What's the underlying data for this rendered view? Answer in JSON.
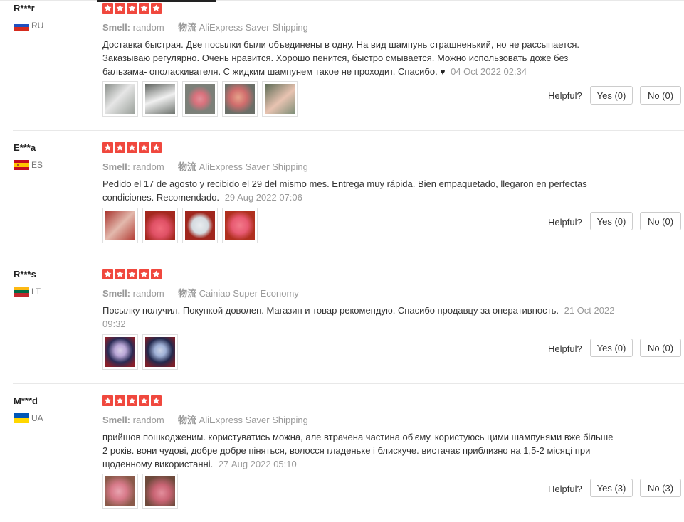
{
  "colors": {
    "star": "#f0483e",
    "accent": "#222222"
  },
  "reviews": [
    {
      "user": "R***r",
      "country_code": "RU",
      "flag": "russia",
      "rating": 5,
      "smell_label": "Smell:",
      "smell_value": "random",
      "shipping_label": "物流",
      "shipping_value": "AliExpress Saver Shipping",
      "text": "Доставка быстрая. Две посылки были объединены в одну. На вид шампунь страшненький, но не рассыпается. Заказываю регулярно. Очень нравится. Хорошо пенится, быстро смывается. Можно использовать доже без бальзама- ополаскивателя. С жидким шампунем такое не проходит. Спасибо.",
      "emoji": "♥",
      "date": "04 Oct 2022 02:34",
      "images": [
        "photo",
        "photo",
        "photo",
        "photo",
        "photo"
      ],
      "helpful_label": "Helpful?",
      "yes_label": "Yes (0)",
      "no_label": "No (0)"
    },
    {
      "user": "E***a",
      "country_code": "ES",
      "flag": "spain",
      "rating": 5,
      "smell_label": "Smell:",
      "smell_value": "random",
      "shipping_label": "物流",
      "shipping_value": "AliExpress Saver Shipping",
      "text": "Pedido el 17 de agosto y recibido el 29 del mismo mes. Entrega muy rápida. Bien empaquetado, llegaron en perfectas condiciones. Recomendado.",
      "emoji": "",
      "date": "29 Aug 2022 07:06",
      "images": [
        "photo",
        "photo",
        "photo",
        "photo"
      ],
      "helpful_label": "Helpful?",
      "yes_label": "Yes (0)",
      "no_label": "No (0)"
    },
    {
      "user": "R***s",
      "country_code": "LT",
      "flag": "lithuania",
      "rating": 5,
      "smell_label": "Smell:",
      "smell_value": "random",
      "shipping_label": "物流",
      "shipping_value": "Cainiao Super Economy",
      "text": "Посылку получил. Покупкой доволен. Магазин и товар рекомендую. Спасибо продавцу за оперативность.",
      "emoji": "",
      "date": "21 Oct 2022 09:32",
      "images": [
        "photo",
        "photo"
      ],
      "helpful_label": "Helpful?",
      "yes_label": "Yes (0)",
      "no_label": "No (0)"
    },
    {
      "user": "M***d",
      "country_code": "UA",
      "flag": "ukraine",
      "rating": 5,
      "smell_label": "Smell:",
      "smell_value": "random",
      "shipping_label": "物流",
      "shipping_value": "AliExpress Saver Shipping",
      "text": "прийшов пошкодженим. користуватись можна, але втрачена частина об'єму. користуюсь цими шампунями вже більше 2 років. вони чудові, добре добре піняться, волосся гладеньке і блискуче. вистачає приблизно на 1,5-2 місяці при щоденному використанні.",
      "emoji": "",
      "date": "27 Aug 2022 05:10",
      "images": [
        "photo",
        "photo"
      ],
      "helpful_label": "Helpful?",
      "yes_label": "Yes (3)",
      "no_label": "No (3)"
    }
  ]
}
